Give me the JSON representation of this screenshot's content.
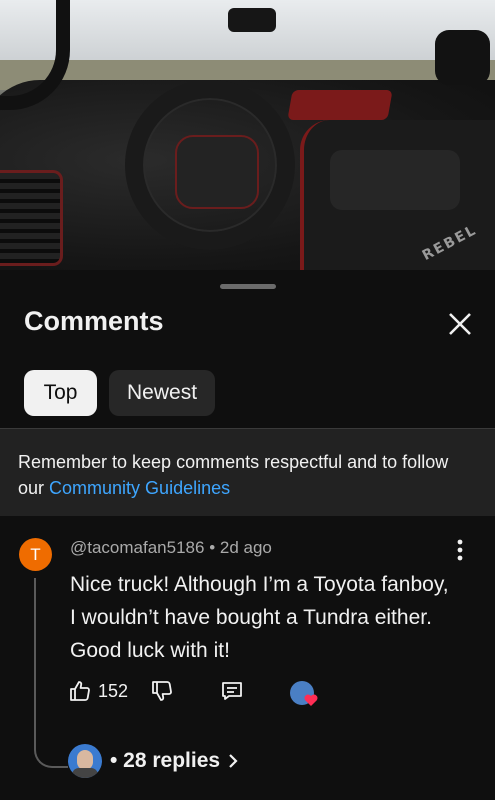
{
  "sheet": {
    "title": "Comments",
    "filters": [
      {
        "label": "Top",
        "selected": true
      },
      {
        "label": "Newest",
        "selected": false
      }
    ]
  },
  "notice": {
    "text": "Remember to keep comments respectful and to follow our ",
    "link": "Community Guidelines"
  },
  "comment": {
    "avatar_initial": "T",
    "avatar_color": "#ef6c00",
    "author": "@tacomafan5186",
    "separator": " • ",
    "time": "2d ago",
    "text": "Nice truck! Although I’m a Toyota fanboy, I wouldn’t have bought a Tundra either. Good luck with it!",
    "likes": "152",
    "replies_label": "• 28 replies"
  },
  "icons": {
    "close": "close-icon",
    "more": "more-vert-icon",
    "like": "thumb-up-icon",
    "dislike": "thumb-down-icon",
    "reply": "comment-icon",
    "hearted": "creator-heart-icon",
    "chevron": "chevron-right-icon"
  },
  "colors": {
    "background": "#0f0f0f",
    "link": "#3ea6ff",
    "heart": "#ff2d55"
  }
}
